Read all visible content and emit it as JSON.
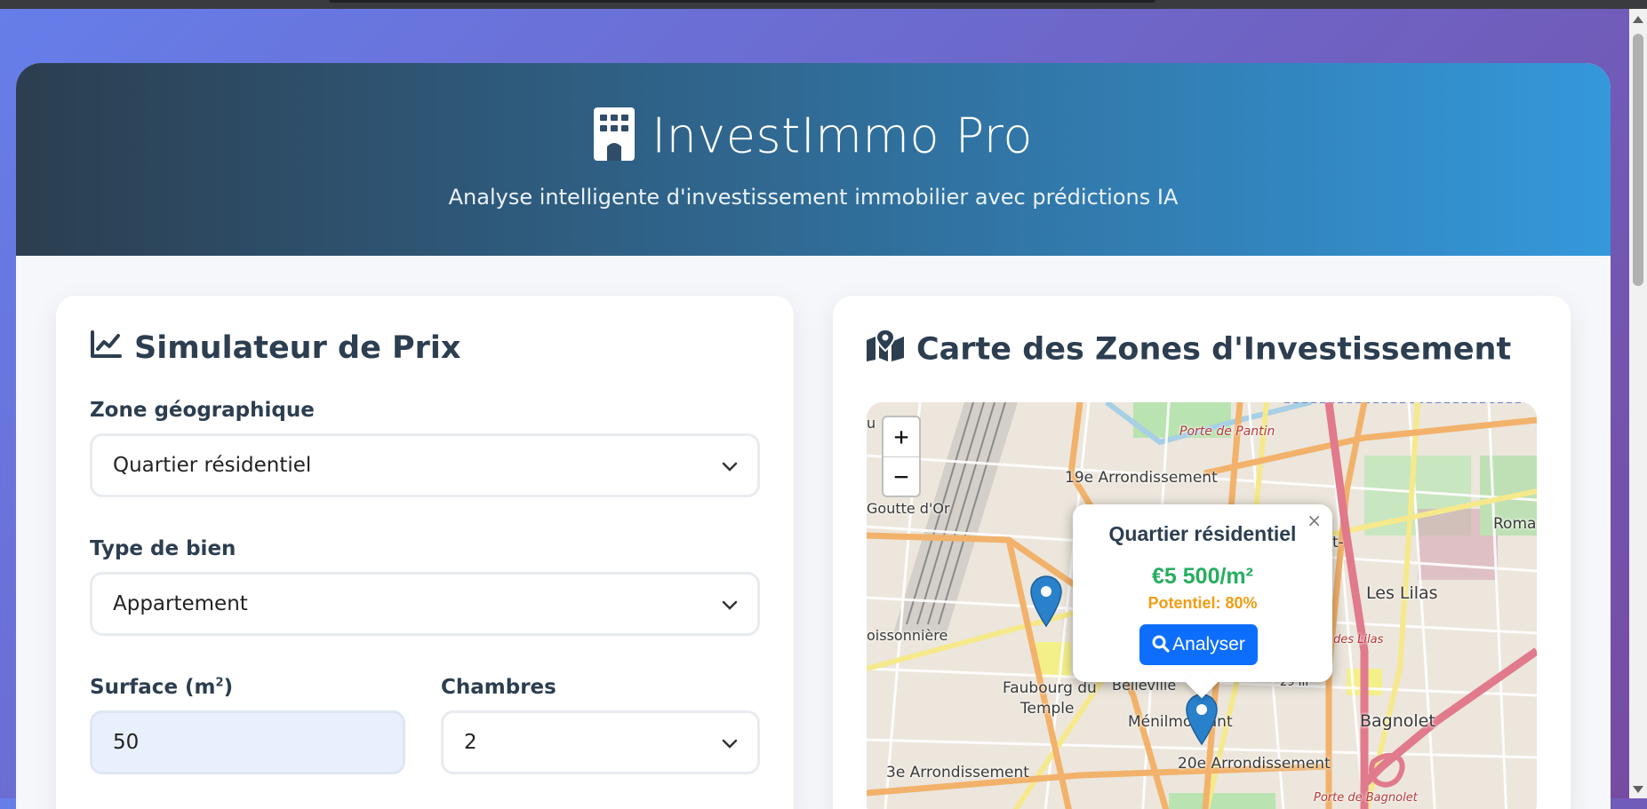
{
  "header": {
    "title": "InvestImmo Pro",
    "subtitle": "Analyse intelligente d'investissement immobilier avec prédictions IA",
    "logo_icon": "building-icon"
  },
  "simulator": {
    "title": "Simulateur de Prix",
    "icon": "chart-line-icon",
    "zone_label": "Zone géographique",
    "zone_value": "Quartier résidentiel",
    "type_label": "Type de bien",
    "type_value": "Appartement",
    "surface_label": "Surface (m",
    "surface_sup": "2",
    "surface_label_end": ")",
    "surface_value": "50",
    "rooms_label": "Chambres",
    "rooms_value": "2"
  },
  "map_card": {
    "title": "Carte des Zones d'Investissement",
    "icon": "map-marked-icon",
    "zoom_in": "+",
    "zoom_out": "−",
    "popup": {
      "close": "×",
      "title": "Quartier résidentiel",
      "price": "€5 500/m²",
      "potential": "Potentiel: 80%",
      "button": "Analyser",
      "button_icon": "search-icon"
    },
    "labels": {
      "porte_pantin": "Porte de Pantin",
      "arr19": "19e Arrondissement",
      "goutte": "Goutte d'Or",
      "roma": "Roma",
      "st": "t-",
      "lilas": "Les Lilas",
      "des_lilas": "des Lilas",
      "poissonniere": "oissonnière",
      "faubourg1": "Faubourg du",
      "faubourg2": "Temple",
      "belleville": "Belleville",
      "arr29": "29 III",
      "menilmontant": "Ménilmontant",
      "bagnolet": "Bagnolet",
      "arr3": "3e Arrondissement",
      "arr20": "20e Arrondissement",
      "porte_bagnolet": "Porte de Bagnolet",
      "u": "u"
    }
  },
  "colors": {
    "accent": "#0d6efd",
    "price": "#27ae60",
    "potential": "#f39c12",
    "marker": "#2a81cb"
  }
}
